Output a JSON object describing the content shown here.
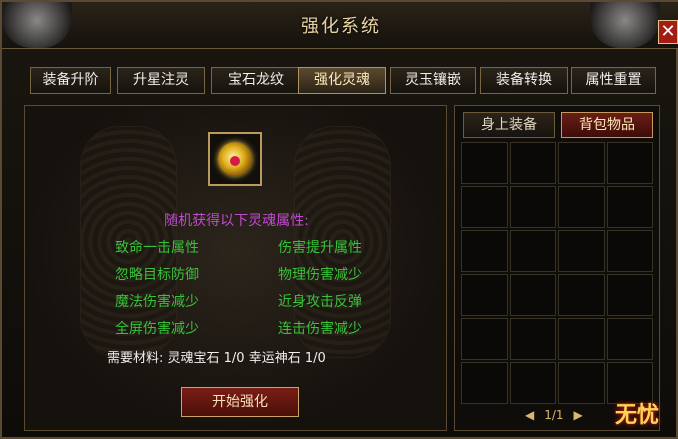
{
  "window": {
    "title": "强化系统",
    "close_icon": "close-icon"
  },
  "tabs": [
    {
      "label": "装备升阶"
    },
    {
      "label": "升星注灵"
    },
    {
      "label": "宝石龙纹"
    },
    {
      "label": "强化灵魂",
      "active": true
    },
    {
      "label": "灵玉镶嵌"
    },
    {
      "label": "装备转换"
    },
    {
      "label": "属性重置"
    }
  ],
  "main": {
    "item_icon": "soul-gem-icon",
    "attr_title": "随机获得以下灵魂属性:",
    "attributes": [
      "致命一击属性",
      "伤害提升属性",
      "忽略目标防御",
      "物理伤害减少",
      "魔法伤害减少",
      "近身攻击反弹",
      "全屏伤害减少",
      "连击伤害减少"
    ],
    "materials": "需要材料: 灵魂宝石 1/0 幸运神石 1/0",
    "start_button": "开始强化"
  },
  "inventory": {
    "tabs": [
      "身上装备",
      "背包物品"
    ],
    "active_tab": "背包物品",
    "pager": {
      "prev": "◀",
      "page": "1/1",
      "next": "▶"
    }
  },
  "logo": "无忧",
  "colors": {
    "title": "#e9d3a3",
    "attribute_green": "#38c23a",
    "attribute_title_purple": "#c24ad0",
    "accent_red": "#a41d14"
  }
}
